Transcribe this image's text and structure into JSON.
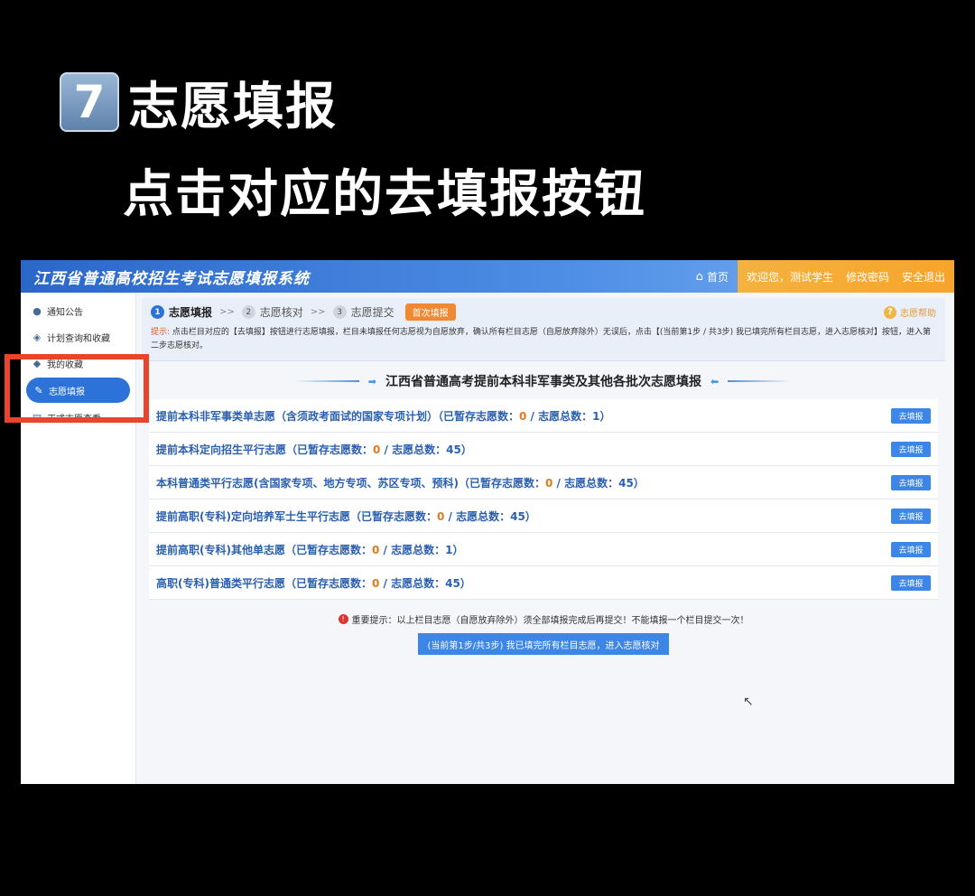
{
  "caption": {
    "badge": "7",
    "title": "志愿填报",
    "subtitle": "点击对应的去填报按钮"
  },
  "topbar": {
    "system_title": "江西省普通高校招生考试志愿填报系统",
    "home": "首页",
    "welcome": "欢迎您，测试学生",
    "change_password": "修改密码",
    "logout": "安全退出"
  },
  "sidebar": {
    "items": [
      {
        "label": "通知公告",
        "icon": "bell-icon"
      },
      {
        "label": "计划查询和收藏",
        "icon": "search-icon"
      },
      {
        "label": "我的收藏",
        "icon": "star-icon"
      },
      {
        "label": "志愿填报",
        "icon": "edit-icon",
        "active": true
      },
      {
        "label": "正式志愿查看",
        "icon": "doc-icon"
      }
    ]
  },
  "steps": {
    "s1_num": "1",
    "s1": "志愿填报",
    "s2_num": "2",
    "s2": "志愿核对",
    "s3_num": "3",
    "s3": "志愿提交",
    "arrow": ">>",
    "badge": "首次填报",
    "help": "志愿帮助"
  },
  "tip": {
    "label": "提示:",
    "text": "点击栏目对应的【去填报】按钮进行志愿填报，栏目未填报任何志愿视为自愿放弃，确认所有栏目志愿（自愿放弃除外）无误后，点击【(当前第1步 / 共3步) 我已填完所有栏目志愿，进入志愿核对】按钮，进入第二步志愿核对。"
  },
  "section_title": "江西省普通高考提前本科非军事类及其他各批次志愿填报",
  "rows": [
    {
      "label": "提前本科非军事类单志愿（含须政考面试的国家专项计划）（已暂存志愿数：",
      "saved": "0",
      "mid": " / 志愿总数：",
      "total": "1",
      "end": "）"
    },
    {
      "label": "提前本科定向招生平行志愿（已暂存志愿数：",
      "saved": "0",
      "mid": " / 志愿总数：",
      "total": "45",
      "end": "）"
    },
    {
      "label": "本科普通类平行志愿(含国家专项、地方专项、苏区专项、预科)（已暂存志愿数：",
      "saved": "0",
      "mid": " / 志愿总数：",
      "total": "45",
      "end": "）"
    },
    {
      "label": "提前高职(专科)定向培养军士生平行志愿（已暂存志愿数：",
      "saved": "0",
      "mid": " / 志愿总数：",
      "total": "45",
      "end": "）"
    },
    {
      "label": "提前高职(专科)其他单志愿（已暂存志愿数：",
      "saved": "0",
      "mid": " / 志愿总数：",
      "total": "1",
      "end": "）"
    },
    {
      "label": "高职(专科)普通类平行志愿（已暂存志愿数：",
      "saved": "0",
      "mid": " / 志愿总数：",
      "total": "45",
      "end": "）"
    }
  ],
  "fill_button": "去填报",
  "notice": "重要提示：以上栏目志愿（自愿放弃除外）须全部填报完成后再提交！不能填报一个栏目提交一次！",
  "submit_button": "(当前第1步/共3步) 我已填完所有栏目志愿，进入志愿核对",
  "colors": {
    "accent": "#2c72d8",
    "highlight": "#e8452c",
    "orange": "#f7a42a"
  }
}
